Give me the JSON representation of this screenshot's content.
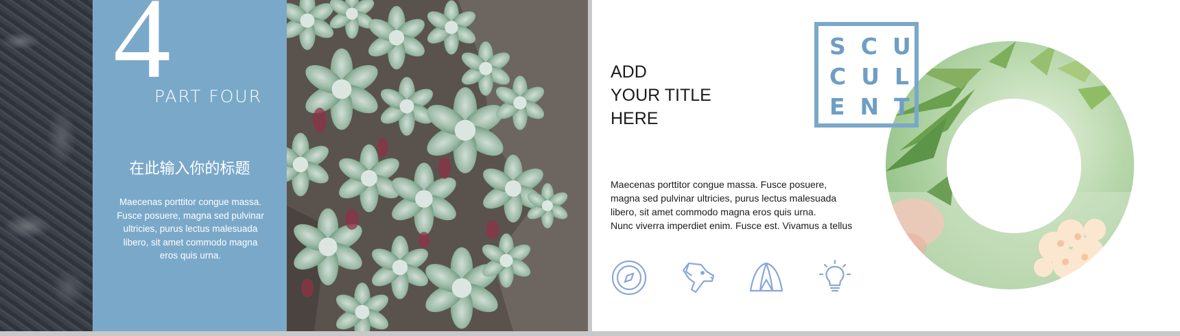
{
  "left_slide": {
    "section_number": "4",
    "section_label": "PART FOUR",
    "cn_title": "在此输入你的标题",
    "body_lines": [
      "Maecenas porttitor congue massa.",
      "Fusce posuere, magna sed pulvinar",
      "ultricies, purus lectus malesuada",
      "libero, sit amet commodo magna",
      "eros quis urna."
    ]
  },
  "right_slide": {
    "title_lines": [
      "ADD",
      "YOUR TITLE",
      "HERE"
    ],
    "body_lines": [
      "Maecenas porttitor congue massa. Fusce posuere,",
      "magna sed pulvinar ultricies, purus lectus malesuada",
      "libero, sit amet commodo magna eros quis urna.",
      "Nunc viverra imperdiet enim. Fusce est. Vivamus a tellus"
    ],
    "logo_rows": [
      "SCU",
      "CUL",
      "ENT"
    ],
    "icons": [
      "compass-icon",
      "dog-icon",
      "tent-icon",
      "lightbulb-icon"
    ]
  },
  "colors": {
    "accent_blue": "#7aa8c9",
    "icon_blue": "#8aa6d8"
  }
}
